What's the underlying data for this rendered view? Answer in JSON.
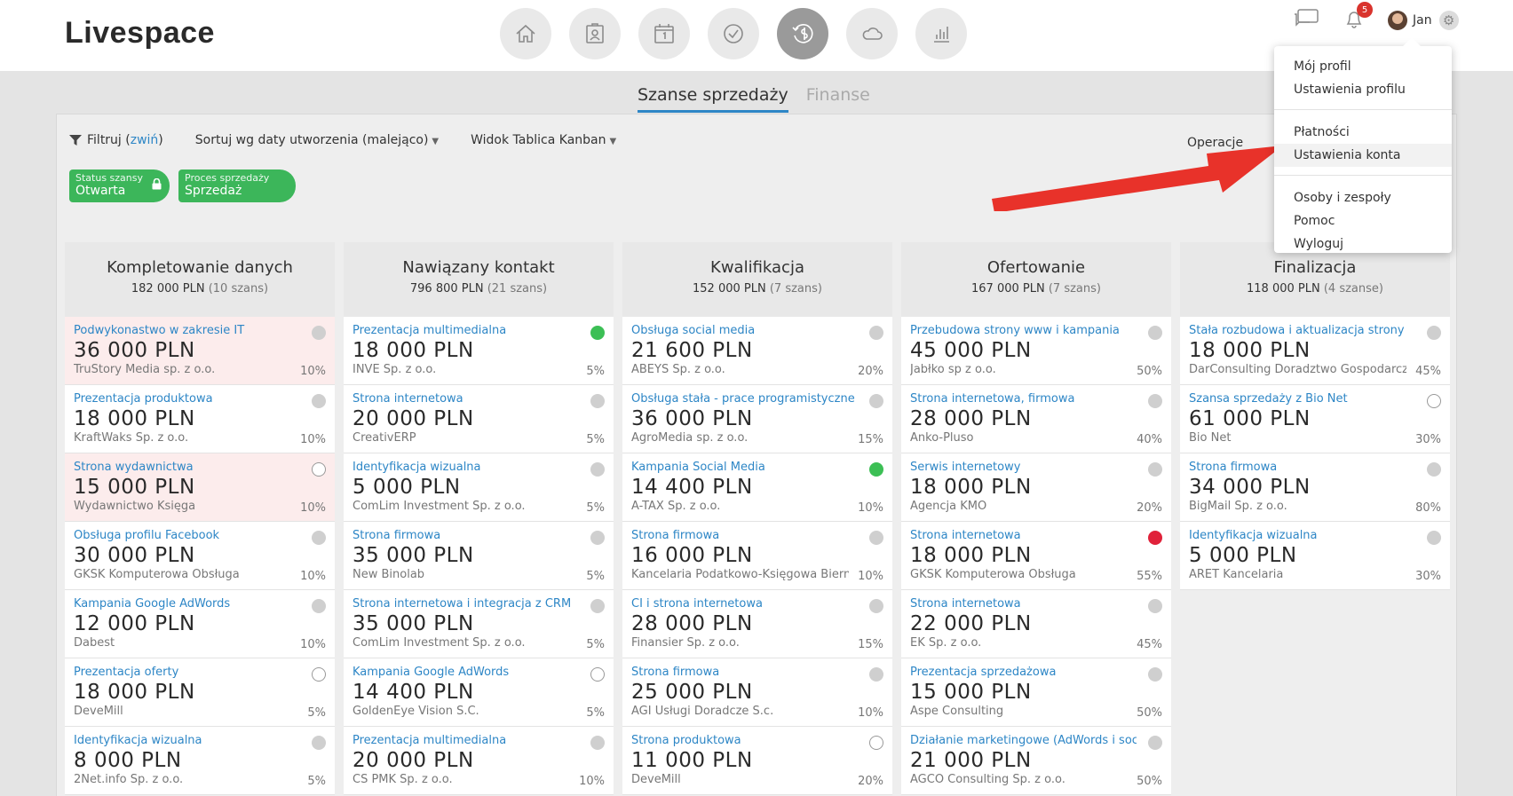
{
  "app": {
    "logo": "Livespace"
  },
  "header": {
    "nav": [
      {
        "icon": "home-icon"
      },
      {
        "icon": "contacts-icon"
      },
      {
        "icon": "calendar-icon"
      },
      {
        "icon": "tasks-icon"
      },
      {
        "icon": "sales-icon",
        "active": true
      },
      {
        "icon": "cloud-icon"
      },
      {
        "icon": "reports-icon"
      }
    ],
    "notifications_count": "5",
    "user_name": "Jan"
  },
  "tabs": [
    {
      "label": "Szanse sprzedaży",
      "active": true
    },
    {
      "label": "Finanse",
      "active": false
    }
  ],
  "toolbar": {
    "filter_label": "Filtruj (",
    "filter_link": "zwiń",
    "filter_close": ")",
    "sort_label": "Sortuj wg daty utworzenia (malejąco)",
    "view_label": "Widok Tablica Kanban",
    "ops_label": "Operacje"
  },
  "chips": [
    {
      "label": "Status szansy",
      "value": "Otwarta"
    },
    {
      "label": "Proces sprzedaży",
      "value": "Sprzedaż"
    }
  ],
  "menu": {
    "items_a": [
      "Mój profil",
      "Ustawienia profilu"
    ],
    "items_b": [
      "Płatności",
      "Ustawienia konta"
    ],
    "items_c": [
      "Osoby i zespoły",
      "Pomoc",
      "Wyloguj"
    ]
  },
  "columns": [
    {
      "title": "Kompletowanie danych",
      "sum": "182 000 PLN",
      "count": "(10 szans)",
      "cards": [
        {
          "name": "Podwykonastwo w zakresie IT",
          "value": "36 000 PLN",
          "company": "TruStory Media sp. z o.o.",
          "pct": "10%",
          "dot": "grey",
          "warn": true
        },
        {
          "name": "Prezentacja produktowa",
          "value": "18 000 PLN",
          "company": "KraftWaks Sp. z o.o.",
          "pct": "10%",
          "dot": "grey"
        },
        {
          "name": "Strona wydawnictwa",
          "value": "15 000 PLN",
          "company": "Wydawnictwo Księga",
          "pct": "10%",
          "dot": "empty",
          "warn": true
        },
        {
          "name": "Obsługa profilu Facebook",
          "value": "30 000 PLN",
          "company": "GKSK Komputerowa Obsługa",
          "pct": "10%",
          "dot": "grey"
        },
        {
          "name": "Kampania Google AdWords",
          "value": "12 000 PLN",
          "company": "Dabest",
          "pct": "10%",
          "dot": "grey"
        },
        {
          "name": "Prezentacja oferty",
          "value": "18 000 PLN",
          "company": "DeveMill",
          "pct": "5%",
          "dot": "empty"
        },
        {
          "name": "Identyfikacja wizualna",
          "value": "8 000 PLN",
          "company": "2Net.info Sp. z o.o.",
          "pct": "5%",
          "dot": "grey"
        }
      ]
    },
    {
      "title": "Nawiązany kontakt",
      "sum": "796 800 PLN",
      "count": "(21 szans)",
      "cards": [
        {
          "name": "Prezentacja multimedialna",
          "value": "18 000 PLN",
          "company": "INVE Sp. z o.o.",
          "pct": "5%",
          "dot": "green"
        },
        {
          "name": "Strona internetowa",
          "value": "20 000 PLN",
          "company": "CreativERP",
          "pct": "5%",
          "dot": "grey"
        },
        {
          "name": "Identyfikacja wizualna",
          "value": "5 000 PLN",
          "company": "ComLim Investment Sp. z o.o.",
          "pct": "5%",
          "dot": "grey"
        },
        {
          "name": "Strona firmowa",
          "value": "35 000 PLN",
          "company": "New Binolab",
          "pct": "5%",
          "dot": "grey"
        },
        {
          "name": "Strona internetowa i integracja z CRM",
          "value": "35 000 PLN",
          "company": "ComLim Investment Sp. z o.o.",
          "pct": "5%",
          "dot": "grey"
        },
        {
          "name": "Kampania Google AdWords",
          "value": "14 400 PLN",
          "company": "GoldenEye Vision S.C.",
          "pct": "5%",
          "dot": "empty"
        },
        {
          "name": "Prezentacja multimedialna",
          "value": "20 000 PLN",
          "company": "CS PMK Sp. z o.o.",
          "pct": "10%",
          "dot": "grey"
        }
      ]
    },
    {
      "title": "Kwalifikacja",
      "sum": "152 000 PLN",
      "count": "(7 szans)",
      "cards": [
        {
          "name": "Obsługa social media",
          "value": "21 600 PLN",
          "company": "ABEYS Sp. z o.o.",
          "pct": "20%",
          "dot": "grey"
        },
        {
          "name": "Obsługa stała - prace programistyczne",
          "value": "36 000 PLN",
          "company": "AgroMedia sp. z o.o.",
          "pct": "15%",
          "dot": "grey"
        },
        {
          "name": "Kampania Social Media",
          "value": "14 400 PLN",
          "company": "A-TAX Sp. z o.o.",
          "pct": "10%",
          "dot": "green"
        },
        {
          "name": "Strona firmowa",
          "value": "16 000 PLN",
          "company": "Kancelaria Podatkowo-Księgowa Biern...",
          "pct": "10%",
          "dot": "grey"
        },
        {
          "name": "CI i strona internetowa",
          "value": "28 000 PLN",
          "company": "Finansier Sp. z o.o.",
          "pct": "15%",
          "dot": "grey"
        },
        {
          "name": "Strona firmowa",
          "value": "25 000 PLN",
          "company": "AGI Usługi Doradcze S.c.",
          "pct": "10%",
          "dot": "grey"
        },
        {
          "name": "Strona produktowa",
          "value": "11 000 PLN",
          "company": "DeveMill",
          "pct": "20%",
          "dot": "empty"
        }
      ]
    },
    {
      "title": "Ofertowanie",
      "sum": "167 000 PLN",
      "count": "(7 szans)",
      "cards": [
        {
          "name": "Przebudowa strony www i kampania",
          "value": "45 000 PLN",
          "company": "Jabłko sp z o.o.",
          "pct": "50%",
          "dot": "grey"
        },
        {
          "name": "Strona internetowa, firmowa",
          "value": "28 000 PLN",
          "company": "Anko-Pluso",
          "pct": "40%",
          "dot": "grey"
        },
        {
          "name": "Serwis internetowy",
          "value": "18 000 PLN",
          "company": "Agencja KMO",
          "pct": "20%",
          "dot": "grey"
        },
        {
          "name": "Strona internetowa",
          "value": "18 000 PLN",
          "company": "GKSK Komputerowa Obsługa",
          "pct": "55%",
          "dot": "red"
        },
        {
          "name": "Strona internetowa",
          "value": "22 000 PLN",
          "company": "EK Sp. z o.o.",
          "pct": "45%",
          "dot": "grey"
        },
        {
          "name": "Prezentacja sprzedażowa",
          "value": "15 000 PLN",
          "company": "Aspe Consulting",
          "pct": "50%",
          "dot": "grey"
        },
        {
          "name": "Działanie marketingowe (AdWords i soc...",
          "value": "21 000 PLN",
          "company": "AGCO Consulting Sp. z o.o.",
          "pct": "50%",
          "dot": "grey"
        }
      ]
    },
    {
      "title": "Finalizacja",
      "sum": "118 000 PLN",
      "count": "(4 szanse)",
      "cards": [
        {
          "name": "Stała rozbudowa i aktualizacja strony",
          "value": "18 000 PLN",
          "company": "DarConsulting Doradztwo Gospodarcze",
          "pct": "45%",
          "dot": "grey"
        },
        {
          "name": "Szansa sprzedaży z Bio Net",
          "value": "61 000 PLN",
          "company": "Bio Net",
          "pct": "30%",
          "dot": "empty"
        },
        {
          "name": "Strona firmowa",
          "value": "34 000 PLN",
          "company": "BigMail Sp. z o.o.",
          "pct": "80%",
          "dot": "grey"
        },
        {
          "name": "Identyfikacja wizualna",
          "value": "5 000 PLN",
          "company": "ARET Kancelaria",
          "pct": "30%",
          "dot": "grey"
        }
      ]
    }
  ],
  "colors": {
    "accent": "#2d86c6",
    "chip": "#3cb65a",
    "badge": "#d9332d",
    "arrow": "#e8322a"
  }
}
